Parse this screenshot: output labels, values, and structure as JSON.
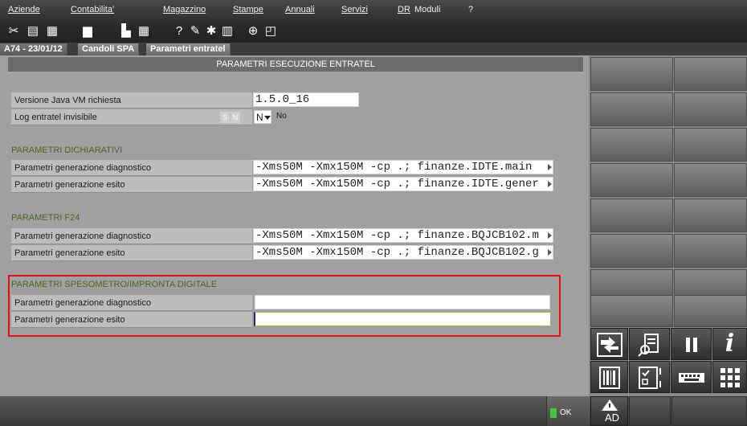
{
  "menu": [
    "Aziende",
    "Contabilita'",
    "Magazzino",
    "Stampe",
    "Annuali",
    "Servizi",
    "DR",
    "Moduli",
    "?"
  ],
  "breadcrumb": [
    "A74 - 23/01/12",
    "Candoli SPA",
    "Parametri entratel"
  ],
  "form": {
    "title": "PARAMETRI ESECUZIONE ENTRATEL",
    "java_label": "Versione Java VM richiesta",
    "java_value": "1.5.0_16",
    "log_label": "Log entratel invisibile",
    "log_opt_s": "S",
    "log_opt_n": "N",
    "log_value": "N",
    "log_desc": "No",
    "section_dich": "PARAMETRI DICHIARATIVI",
    "dich_diag_label": "Parametri generazione diagnostico",
    "dich_diag_value": "-Xms50M -Xmx150M -cp .; finanze.IDTE.main",
    "dich_esito_label": "Parametri generazione esito",
    "dich_esito_value": "-Xms50M -Xmx150M -cp .; finanze.IDTE.gener",
    "section_f24": "PARAMETRI F24",
    "f24_diag_label": "Parametri generazione diagnostico",
    "f24_diag_value": "-Xms50M -Xmx150M -cp .; finanze.BQJCB102.m",
    "f24_esito_label": "Parametri generazione esito",
    "f24_esito_value": "-Xms50M -Xmx150M -cp .; finanze.BQJCB102.g",
    "section_spes": "PARAMETRI SPESOMETRO/IMPRONTA DIGITALE",
    "spes_diag_label": "Parametri generazione diagnostico",
    "spes_diag_value": "",
    "spes_esito_label": "Parametri generazione esito",
    "spes_esito_value": ""
  },
  "icons": {
    "toolbar": [
      "scissors-icon",
      "copy-icon",
      "paste-icon",
      "print-icon",
      "calculator-icon",
      "grid-icon",
      "help-icon",
      "edit-icon",
      "tools-icon",
      "table-icon",
      "plus-icon",
      "window-icon"
    ],
    "side": [
      "transfer-icon",
      "document-search-icon",
      "pause-icon",
      "info-icon",
      "barcode-icon",
      "checklist-icon",
      "keyboard-icon",
      "apps-icon",
      "warning-ad-icon"
    ]
  },
  "side": {
    "ad_label": "AD"
  },
  "bottom": {
    "ok_label": "OK"
  },
  "colors": {
    "highlight": "#e01212",
    "section": "#4a6a1e",
    "ok_indicator": "#3ec93e"
  }
}
